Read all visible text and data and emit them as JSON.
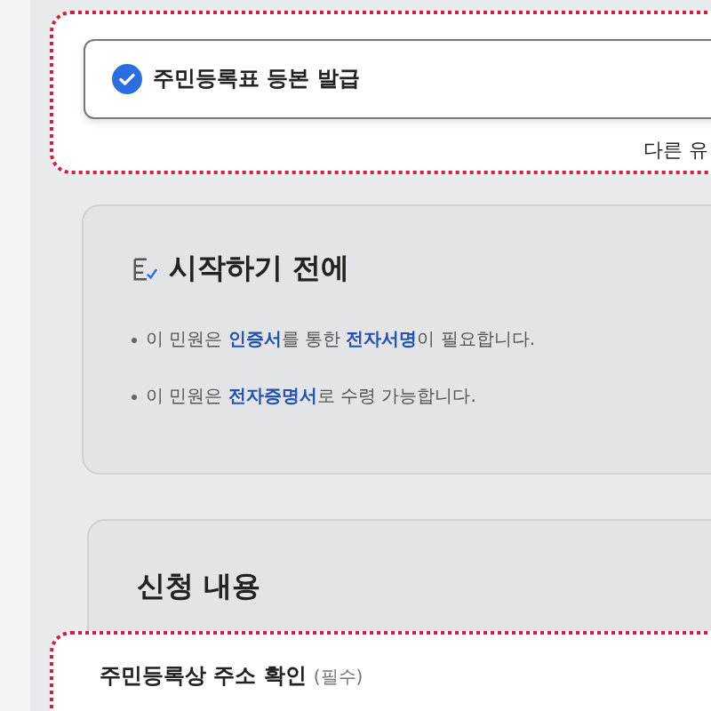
{
  "service_option": {
    "label": "주민등록표 등본 발급",
    "selected": true
  },
  "other_type_link": "다른 유",
  "before_start": {
    "title": "시작하기 전에",
    "notes": [
      "이 민원은 **인증서**를 통한 **전자서명**이 필요합니다.",
      "이 민원은 **전자증명서**로 수령 가능합니다."
    ]
  },
  "application": {
    "title": "신청 내용",
    "field_label": "주민등록상 주소 확인",
    "field_hint": "(필수)"
  }
}
